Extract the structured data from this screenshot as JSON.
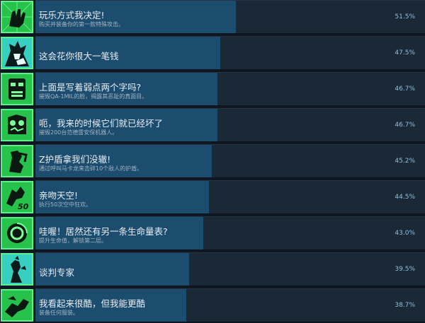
{
  "achievements": [
    {
      "title": "玩乐方式我决定!",
      "desc": "购买并装备你的第一款特殊攻击。",
      "percent": "51.5%",
      "fill": 0.515,
      "badge_color": "#27c24c",
      "icon": "hand-grab-icon"
    },
    {
      "title": "这会花你很大一笔钱",
      "desc": "",
      "percent": "47.5%",
      "fill": 0.475,
      "badge_color": "#37d0c0",
      "icon": "character-portrait-icon"
    },
    {
      "title": "上面是写着弱点两个字吗?",
      "desc": "摧毁QA-1MIL的脸，揭露其恶趾的真面目。",
      "percent": "46.7%",
      "fill": 0.467,
      "badge_color": "#27c24c",
      "icon": "robot-face-icon"
    },
    {
      "title": "呃，我来的时候它们就已经坏了",
      "desc": "摧毁200台范德雷安保机器人。",
      "percent": "46.7%",
      "fill": 0.467,
      "badge_color": "#27c24c",
      "icon": "broken-robot-icon"
    },
    {
      "title": "Z护盾拿我们没辙!",
      "desc": "通过呼叫马卡龙来击碎10个敌人的护盾。",
      "percent": "45.2%",
      "fill": 0.452,
      "badge_color": "#27c24c",
      "icon": "shield-break-icon"
    },
    {
      "title": "亲吻天空!",
      "desc": "执行50次空中狂欢。",
      "percent": "44.5%",
      "fill": 0.445,
      "badge_color": "#27c24c",
      "icon": "sky-kiss-50-icon"
    },
    {
      "title": "哇喔！居然还有另一条生命量表?",
      "desc": "提升生命值，解锁第二层。",
      "percent": "43.0%",
      "fill": 0.43,
      "badge_color": "#27c24c",
      "icon": "health-gauge-icon"
    },
    {
      "title": "谈判专家",
      "desc": "",
      "percent": "39.5%",
      "fill": 0.395,
      "badge_color": "#37d0c0",
      "icon": "negotiator-icon"
    },
    {
      "title": "我看起来很酷，但我能更酷",
      "desc": "装备任何服装。",
      "percent": "38.7%",
      "fill": 0.387,
      "badge_color": "#27c24c",
      "icon": "cool-outfit-icon"
    }
  ]
}
